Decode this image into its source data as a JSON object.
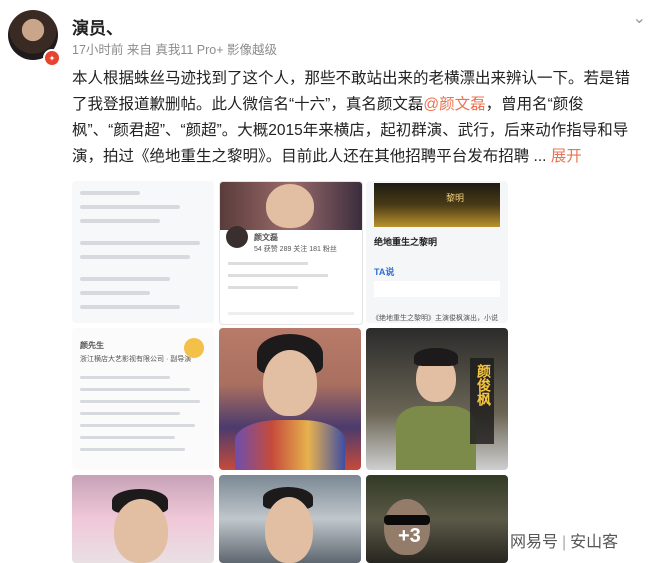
{
  "post": {
    "username": "演员、",
    "meta": "17小时前 来自 真我11 Pro+ 影像越级",
    "text_before_mention": "本人根据蛛丝马迹找到了这个人，那些不敢站出来的老横漂出来辨认一下。若是错了我登报道歉删帖。此人微信名“十六”，真名颜文磊",
    "mention": "@颜文磊",
    "text_after_mention": "，曾用名“颜俊枫”、“颜君超”、“颜超”。大概2015年来横店，起初群演、武行，后来动作指导和导演，拍过《绝地重生之黎明》。目前此人还在其他招聘平台发布招聘 ...",
    "expand_label": "展开"
  },
  "images": {
    "overflow_count": "+3",
    "profile_name": "颜文磊",
    "profile_stats": "54 获赞   289 关注   181 粉丝",
    "card_title": "绝地重生之黎明",
    "card_brand": "TA说",
    "card_caption": "《绝地重生之黎明》主演俊枫演出，小说",
    "poster_text": "黎明",
    "poster_vertical": "颜俊枫",
    "card2_name": "颜先生",
    "card2_company": "浙江横店大艺影视有限公司 · 副导演"
  },
  "watermark": {
    "left": "网易号",
    "right": "安山客"
  },
  "colors": {
    "accent": "#eb7350",
    "link_blue": "#2f6fd6"
  },
  "icons": {
    "more": "chevron-down-icon",
    "badge": "verified-badge-icon"
  }
}
